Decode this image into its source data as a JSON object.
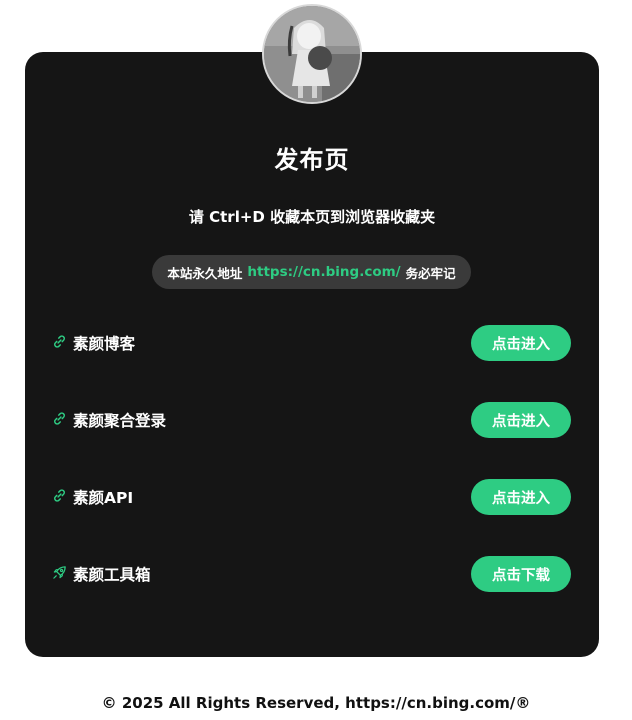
{
  "header": {
    "title": "发布页",
    "subtitle": "请 Ctrl+D 收藏本页到浏览器收藏夹"
  },
  "notice": {
    "prefix": "本站永久地址",
    "url": "https://cn.bing.com/",
    "suffix": "务必牢记"
  },
  "links": [
    {
      "icon": "link-icon",
      "label": "素颜博客",
      "button": "点击进入"
    },
    {
      "icon": "link-icon",
      "label": "素颜聚合登录",
      "button": "点击进入"
    },
    {
      "icon": "link-icon",
      "label": "素颜API",
      "button": "点击进入"
    },
    {
      "icon": "rocket-icon",
      "label": "素颜工具箱",
      "button": "点击下载"
    }
  ],
  "footer": {
    "text": "© 2025 All Rights Reserved, https://cn.bing.com/®"
  },
  "colors": {
    "accent": "#2ecc83",
    "card": "#151515",
    "pill": "#3a3a3a"
  }
}
